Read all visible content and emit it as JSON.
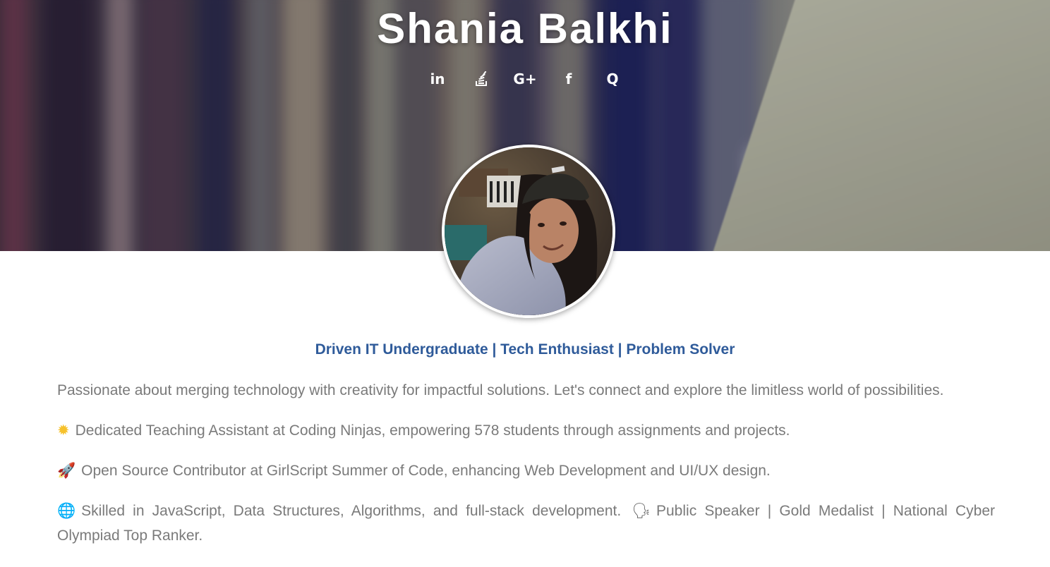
{
  "hero": {
    "name": "Shania Balkhi",
    "social": [
      {
        "name": "linkedin-icon",
        "glyph": "in"
      },
      {
        "name": "stackoverflow-icon",
        "glyph": ""
      },
      {
        "name": "google-plus-icon",
        "glyph": "G+"
      },
      {
        "name": "facebook-icon",
        "glyph": "f"
      },
      {
        "name": "quora-icon",
        "glyph": "Q"
      }
    ]
  },
  "profile": {
    "headline": "Driven IT Undergraduate | Tech Enthusiast | Problem Solver",
    "bio": {
      "intro": "Passionate about merging technology with creativity for impactful solutions. Let's connect and explore the limitless world of possibilities.",
      "teaching": "Dedicated Teaching Assistant at Coding Ninjas, empowering 578 students through assignments and projects.",
      "opensource": "Open Source Contributor at GirlScript Summer of Code, enhancing Web Development and UI/UX design.",
      "skills": "Skilled in JavaScript, Data Structures, Algorithms, and full-stack development.",
      "speaker": "Public Speaker | Gold Medalist | National Cyber Olympiad Top Ranker."
    },
    "emoji": {
      "sun": "✹",
      "rocket": "🚀",
      "globe": "🌐",
      "speaker": "🗣"
    }
  },
  "colors": {
    "headline": "#2f5b9a",
    "body_text": "#7a7a7a",
    "hero_text": "#ffffff"
  }
}
